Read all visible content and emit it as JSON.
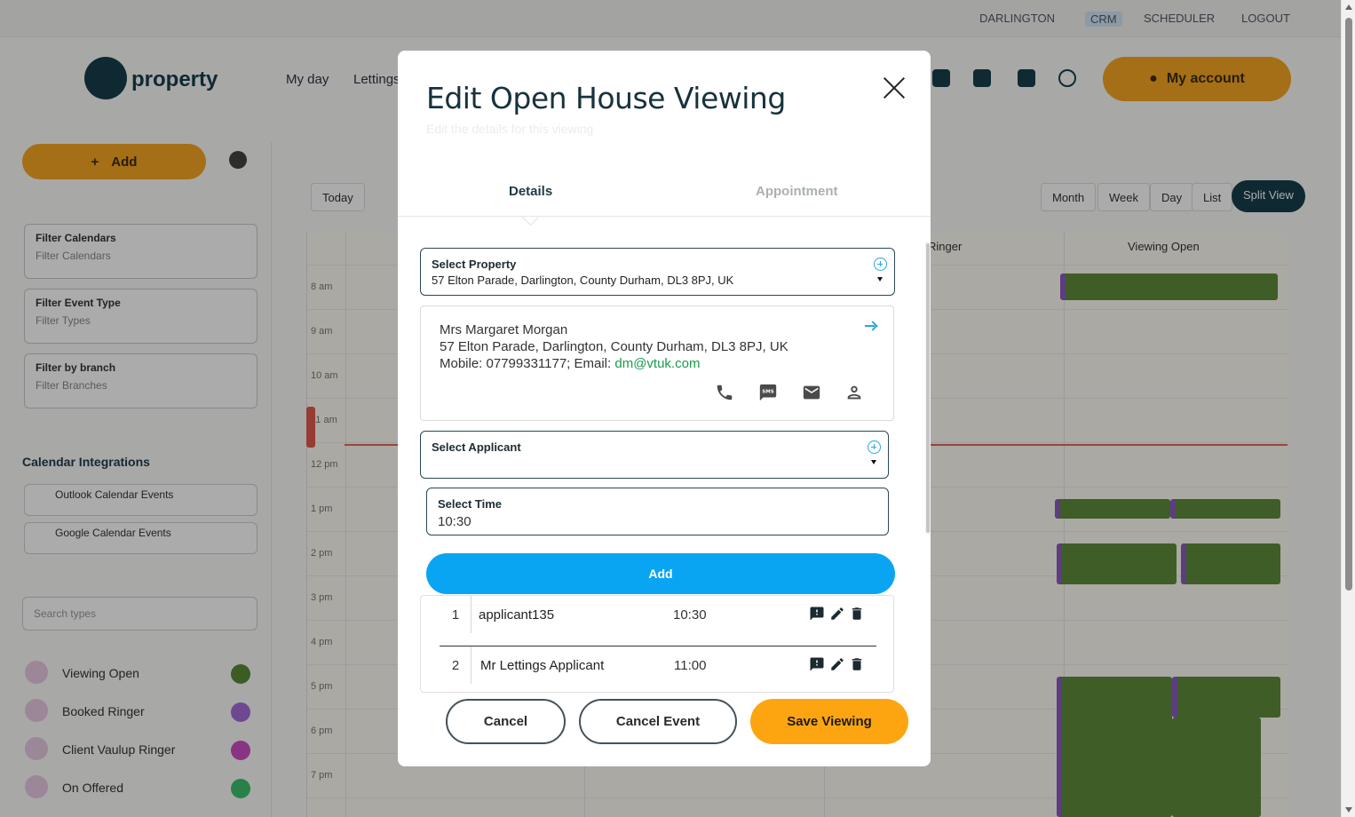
{
  "background": {
    "toplinks": [
      "DARLINGTON",
      "CRM",
      "SCHEDULER",
      "LOGOUT"
    ],
    "logo_text": "property",
    "nav_links": [
      "My day",
      "Lettings"
    ],
    "my_account_label": "My account",
    "sidebar_add_label": "Add",
    "filters": [
      {
        "label": "Filter Calendars",
        "value": "Filter Calendars"
      },
      {
        "label": "Filter Event Type",
        "value": "Filter Types"
      },
      {
        "label": "Filter by branch",
        "value": "Filter Branches"
      }
    ],
    "calendar_integrations_label": "Calendar Integrations",
    "integrations": [
      "Outlook Calendar Events",
      "Google Calendar Events"
    ],
    "search_placeholder": "Search types",
    "event_types": [
      {
        "label": "Viewing Open",
        "color": "#5a8a3a"
      },
      {
        "label": "Booked Ringer",
        "color": "#a56cd8"
      },
      {
        "label": "Client Vaulup Ringer",
        "color": "#d04cc4"
      },
      {
        "label": "On Offered",
        "color": "#3dc06a"
      }
    ],
    "view_buttons": [
      "Today",
      "Month",
      "Week",
      "Day",
      "List",
      "Split View"
    ],
    "column_heads": [
      "Ringer",
      "Viewing Open"
    ],
    "time_labels": [
      "8 am",
      "9 am",
      "10 am",
      "11 am",
      "12 pm",
      "1 pm",
      "2 pm",
      "3 pm",
      "4 pm",
      "5 pm",
      "6 pm",
      "7 pm"
    ]
  },
  "modal": {
    "title": "Edit Open House Viewing",
    "subtitle": "Edit the details for this viewing",
    "tabs": {
      "details": "Details",
      "appointment": "Appointment"
    },
    "select_property": {
      "label": "Select Property",
      "value": "57 Elton Parade, Darlington, County Durham, DL3 8PJ, UK"
    },
    "owner": {
      "name": "Mrs Margaret Morgan",
      "address": "57 Elton Parade, Darlington, County Durham, DL3 8PJ, UK",
      "contact_prefix": "Mobile: 07799331177; Email: ",
      "email": "dm@vtuk.com"
    },
    "select_applicant": {
      "label": "Select Applicant",
      "value": ""
    },
    "select_time": {
      "label": "Select Time",
      "value": "10:30"
    },
    "add_label": "Add",
    "applicants": [
      {
        "num": "1",
        "name": "applicant135",
        "time": "10:30"
      },
      {
        "num": "2",
        "name": "Mr Lettings Applicant",
        "time": "11:00"
      }
    ],
    "buttons": {
      "cancel": "Cancel",
      "cancel_event": "Cancel Event",
      "save": "Save Viewing"
    },
    "colors": {
      "accent_blue": "#0aa5f2",
      "save_orange": "#fda511",
      "email_green": "#1a9b4b",
      "title_dark": "#17323d"
    }
  }
}
